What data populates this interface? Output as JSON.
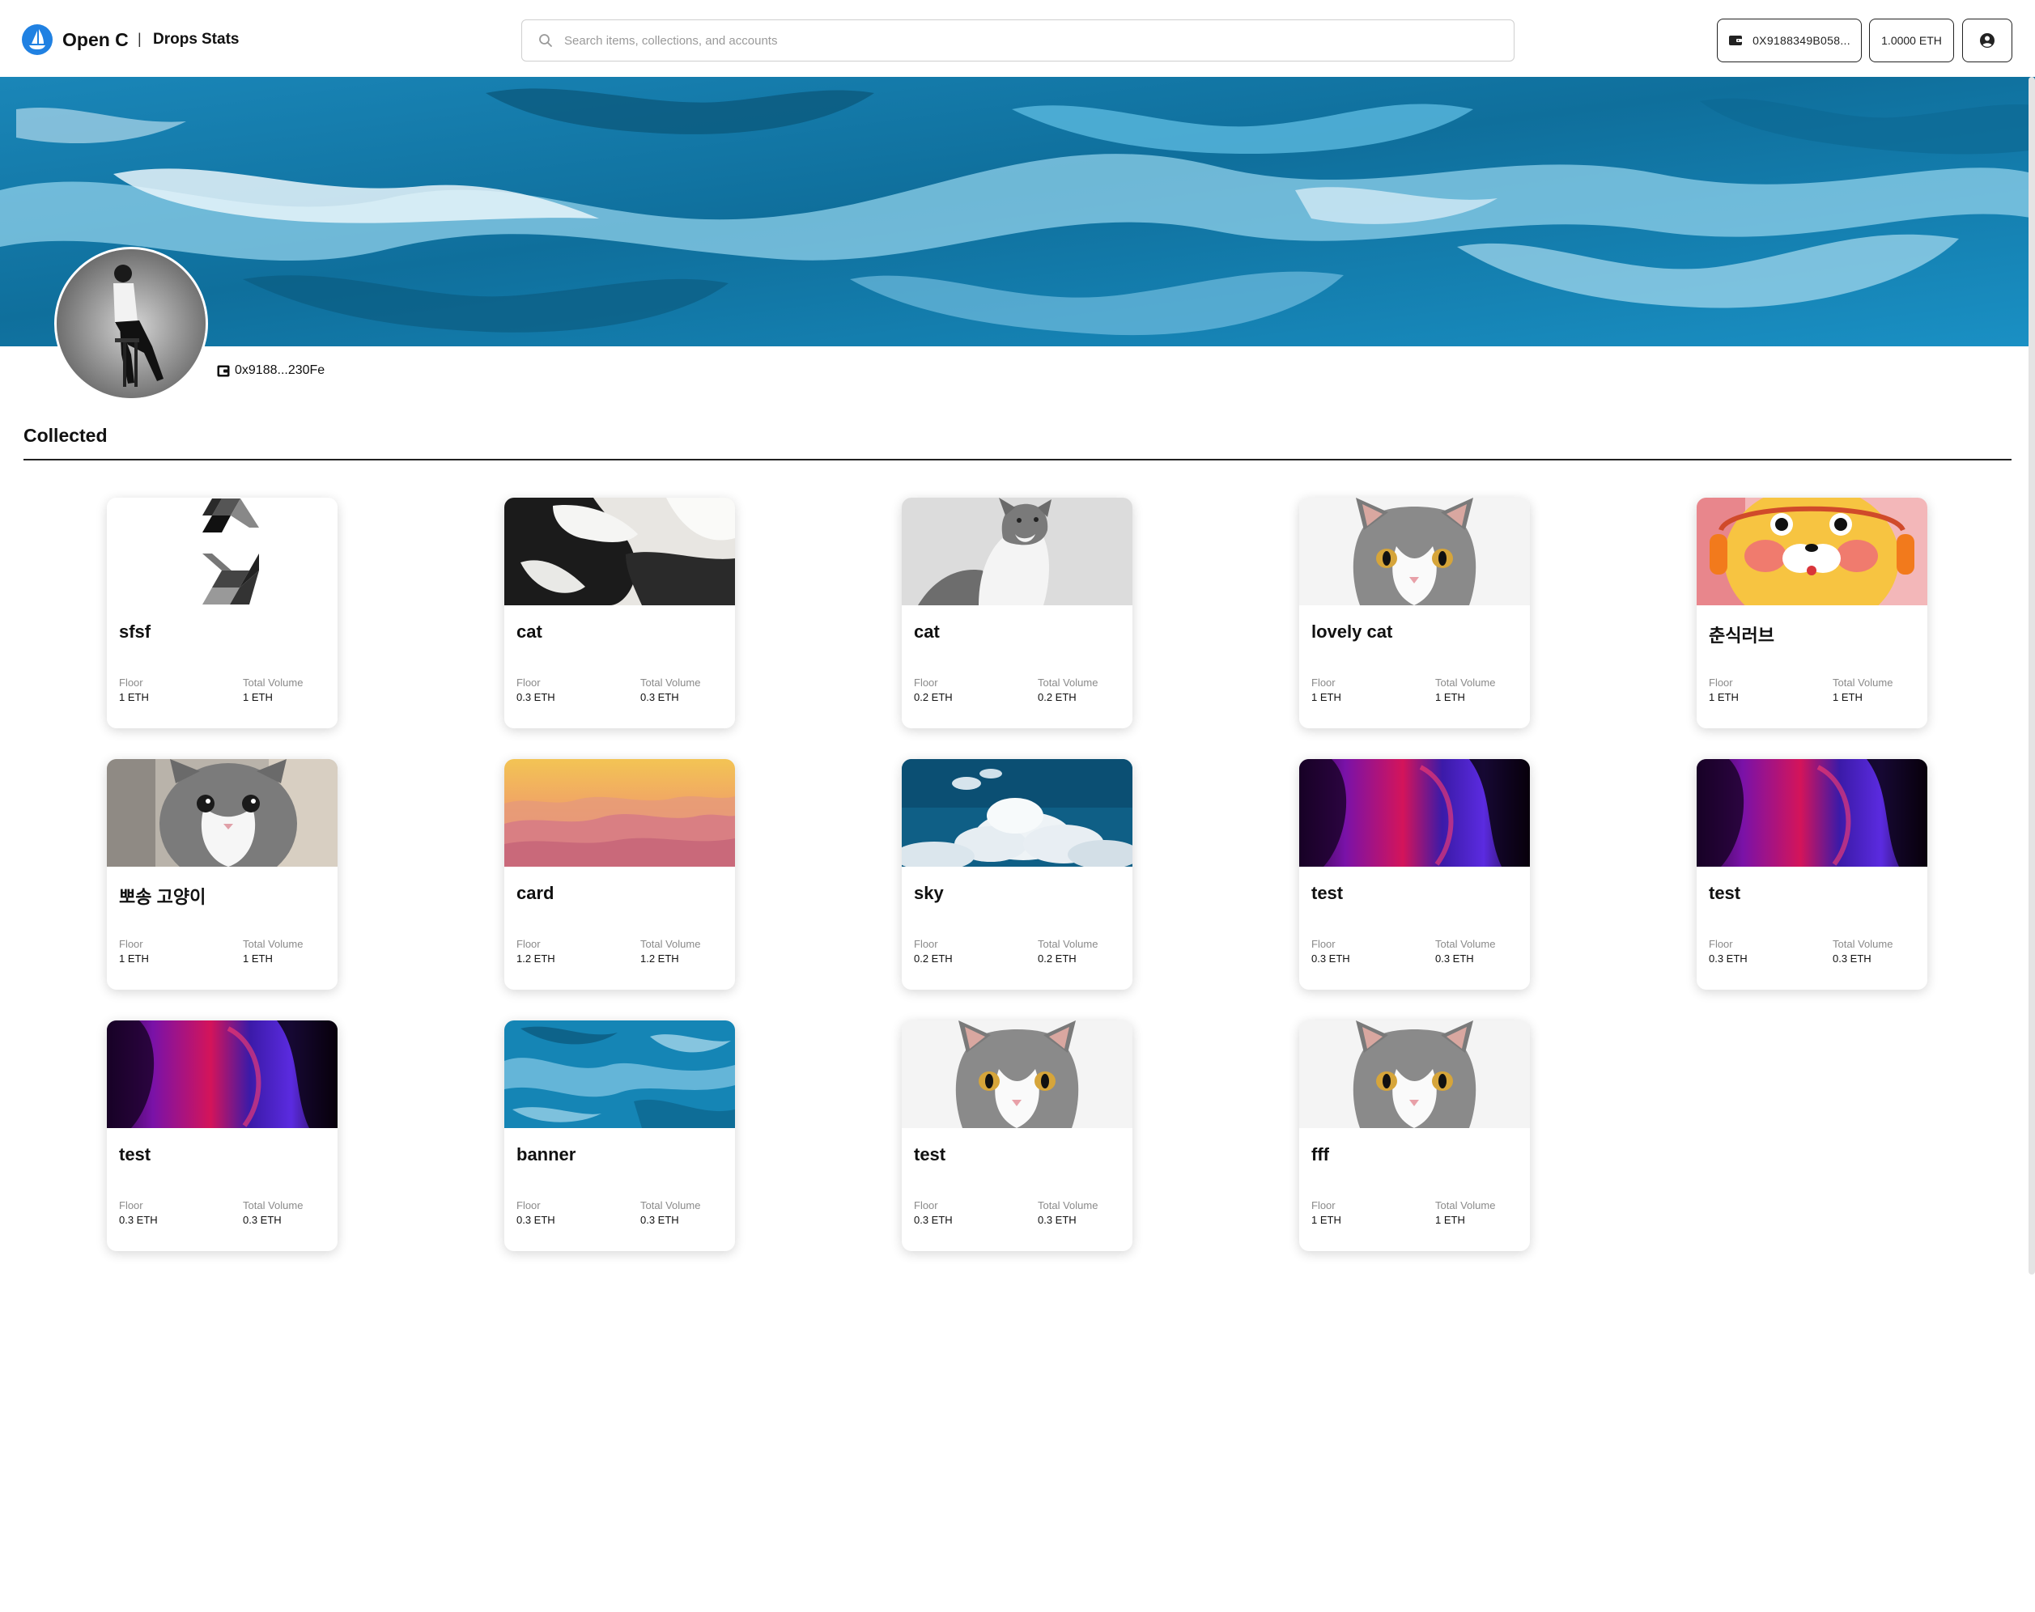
{
  "header": {
    "logo_text": "Open C",
    "separator": "|",
    "nav": [
      {
        "label": "Drops"
      },
      {
        "label": "Stats"
      }
    ],
    "search_placeholder": "Search items, collections, and accounts",
    "wallet_address": "0X9188349B058...",
    "balance": "1.0000 ETH"
  },
  "profile": {
    "address": "0x9188...230Fe"
  },
  "section": {
    "title": "Collected"
  },
  "stat_labels": {
    "floor": "Floor",
    "volume": "Total Volume"
  },
  "items": [
    {
      "name": "sfsf",
      "floor": "1 ETH",
      "volume": "1 ETH",
      "image": "solidity-logo"
    },
    {
      "name": "cat",
      "floor": "0.3 ETH",
      "volume": "0.3 ETH",
      "image": "black-white-cat"
    },
    {
      "name": "cat",
      "floor": "0.2 ETH",
      "volume": "0.2 ETH",
      "image": "grey-cat-looking-up"
    },
    {
      "name": "lovely cat",
      "floor": "1 ETH",
      "volume": "1 ETH",
      "image": "grey-white-cat"
    },
    {
      "name": "춘식러브",
      "floor": "1 ETH",
      "volume": "1 ETH",
      "image": "cartoon-cat-headphones"
    },
    {
      "name": "뽀송 고양이",
      "floor": "1 ETH",
      "volume": "1 ETH",
      "image": "fluffy-kitten"
    },
    {
      "name": "card",
      "floor": "1.2 ETH",
      "volume": "1.2 ETH",
      "image": "sunset-mountains"
    },
    {
      "name": "sky",
      "floor": "0.2 ETH",
      "volume": "0.2 ETH",
      "image": "sky-clouds"
    },
    {
      "name": "test",
      "floor": "0.3 ETH",
      "volume": "0.3 ETH",
      "image": "neon-abstract"
    },
    {
      "name": "test",
      "floor": "0.3 ETH",
      "volume": "0.3 ETH",
      "image": "neon-abstract"
    },
    {
      "name": "test",
      "floor": "0.3 ETH",
      "volume": "0.3 ETH",
      "image": "neon-abstract"
    },
    {
      "name": "banner",
      "floor": "0.3 ETH",
      "volume": "0.3 ETH",
      "image": "blue-marble"
    },
    {
      "name": "test",
      "floor": "0.3 ETH",
      "volume": "0.3 ETH",
      "image": "grey-white-cat"
    },
    {
      "name": "fff",
      "floor": "1 ETH",
      "volume": "1 ETH",
      "image": "grey-white-cat"
    }
  ],
  "colors": {
    "brand": "#2081e2",
    "banner_blue": "#1a8fc4"
  }
}
